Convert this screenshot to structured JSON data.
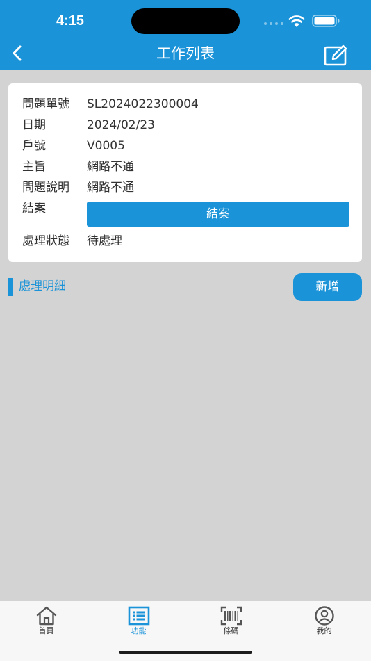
{
  "status_bar": {
    "time": "4:15"
  },
  "nav": {
    "title": "工作列表",
    "back_icon": "chevron-left-icon",
    "edit_icon": "edit-icon"
  },
  "details": {
    "ticket_no_label": "問題單號",
    "ticket_no": "SL2024022300004",
    "date_label": "日期",
    "date": "2024/02/23",
    "account_label": "戶號",
    "account": "V0005",
    "subject_label": "主旨",
    "subject": "網路不通",
    "description_label": "問題說明",
    "description": "網路不通",
    "close_label": "結案",
    "close_button_label": "結案",
    "status_label": "處理狀態",
    "status": "待處理"
  },
  "section": {
    "title": "處理明細",
    "add_button_label": "新增"
  },
  "tabs": [
    {
      "label": "首頁",
      "icon": "home-icon",
      "active": false
    },
    {
      "label": "功能",
      "icon": "list-icon",
      "active": true
    },
    {
      "label": "條碼",
      "icon": "barcode-icon",
      "active": false
    },
    {
      "label": "我的",
      "icon": "user-icon",
      "active": false
    }
  ],
  "colors": {
    "accent": "#1a93d8",
    "background": "#d3d3d3",
    "card": "#ffffff",
    "text": "#333333"
  }
}
